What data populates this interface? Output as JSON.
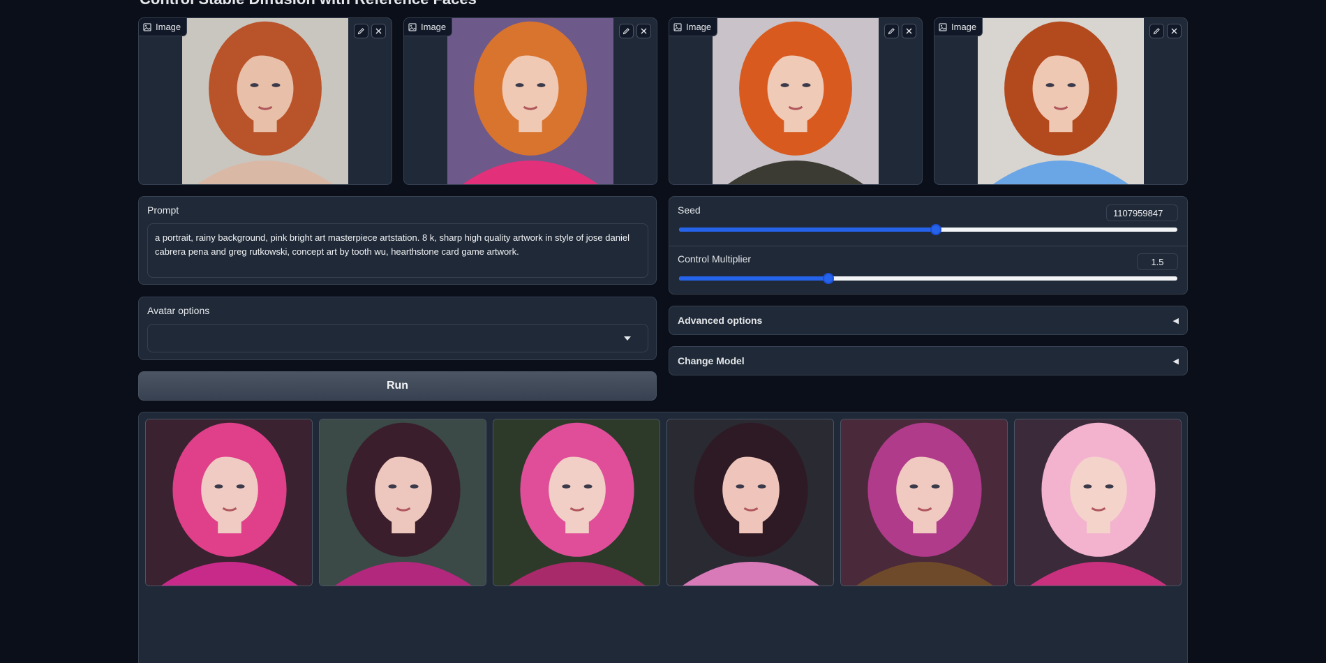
{
  "app": {
    "title": "Control Stable Diffusion with Reference Faces"
  },
  "reference_images": [
    {
      "label": "Image",
      "bg": "#c9c6c0",
      "hair": "#b9532a",
      "skin": "#e8bfa8",
      "clothes": "#d9b8a6"
    },
    {
      "label": "Image",
      "bg": "#6d5a8a",
      "hair": "#d9742f",
      "skin": "#f0c9b4",
      "clothes": "#e2307a"
    },
    {
      "label": "Image",
      "bg": "#c9c2c8",
      "hair": "#d95a1e",
      "skin": "#efcab6",
      "clothes": "#3b3b33"
    },
    {
      "label": "Image",
      "bg": "#d8d4cf",
      "hair": "#b34a1e",
      "skin": "#efc8b3",
      "clothes": "#6aa6e6"
    }
  ],
  "prompt": {
    "label": "Prompt",
    "value": "a portrait, rainy background, pink bright art masterpiece artstation. 8 k, sharp high quality artwork in style of jose daniel cabrera pena and greg rutkowski, concept art by tooth wu, hearthstone card game artwork."
  },
  "avatar_options": {
    "label": "Avatar options",
    "selected": ""
  },
  "run_button": {
    "label": "Run"
  },
  "seed": {
    "label": "Seed",
    "value": "1107959847",
    "fraction": 0.516
  },
  "control_multiplier": {
    "label": "Control Multiplier",
    "value": "1.5",
    "fraction": 0.3
  },
  "advanced_options": {
    "label": "Advanced options",
    "icon": "◀"
  },
  "change_model": {
    "label": "Change Model",
    "icon": "◀"
  },
  "gallery": [
    {
      "bg": "#3a2230",
      "hair": "#e0408a",
      "skin": "#f0cbc3",
      "clothes": "#c82a8a"
    },
    {
      "bg": "#3b4a46",
      "hair": "#3a1e2c",
      "skin": "#edc6bd",
      "clothes": "#b2287c"
    },
    {
      "bg": "#2d3a2a",
      "hair": "#e04e9a",
      "skin": "#f2cfc6",
      "clothes": "#a82a6a"
    },
    {
      "bg": "#2a2a33",
      "hair": "#2e1a24",
      "skin": "#efc5bb",
      "clothes": "#d879b8"
    },
    {
      "bg": "#4a2a3a",
      "hair": "#b03b8b",
      "skin": "#f0c9c0",
      "clothes": "#6e4a2a"
    },
    {
      "bg": "#3a2a3a",
      "hair": "#f3b3cf",
      "skin": "#f4d3cb",
      "clothes": "#c9307e"
    }
  ]
}
